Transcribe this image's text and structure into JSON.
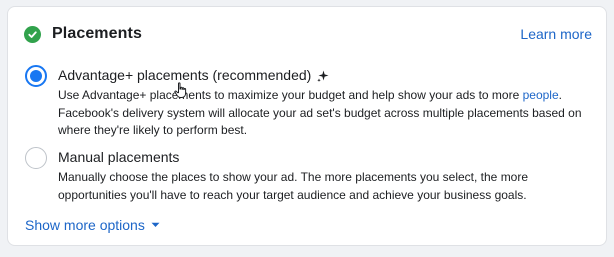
{
  "header": {
    "title": "Placements",
    "learn_more": "Learn more"
  },
  "options": [
    {
      "label": "Advantage+ placements (recommended)",
      "selected": true,
      "desc_prefix": "Use Advantage+ placements to maximize your budget and help show your ads to more ",
      "desc_link": "people",
      "desc_suffix": ". Facebook's delivery system will allocate your ad set's budget across multiple placements based on where they're likely to perform best."
    },
    {
      "label": "Manual placements",
      "selected": false,
      "desc": "Manually choose the places to show your ad. The more placements you select, the more opportunities you'll have to reach your target audience and achieve your business goals."
    }
  ],
  "footer": {
    "show_more": "Show more options"
  },
  "colors": {
    "accent": "#1877f2",
    "link": "#1d66c8",
    "success": "#31a24c"
  },
  "icons": [
    "check-icon",
    "sparkle-icon",
    "hand-cursor-icon",
    "caret-down-icon"
  ]
}
